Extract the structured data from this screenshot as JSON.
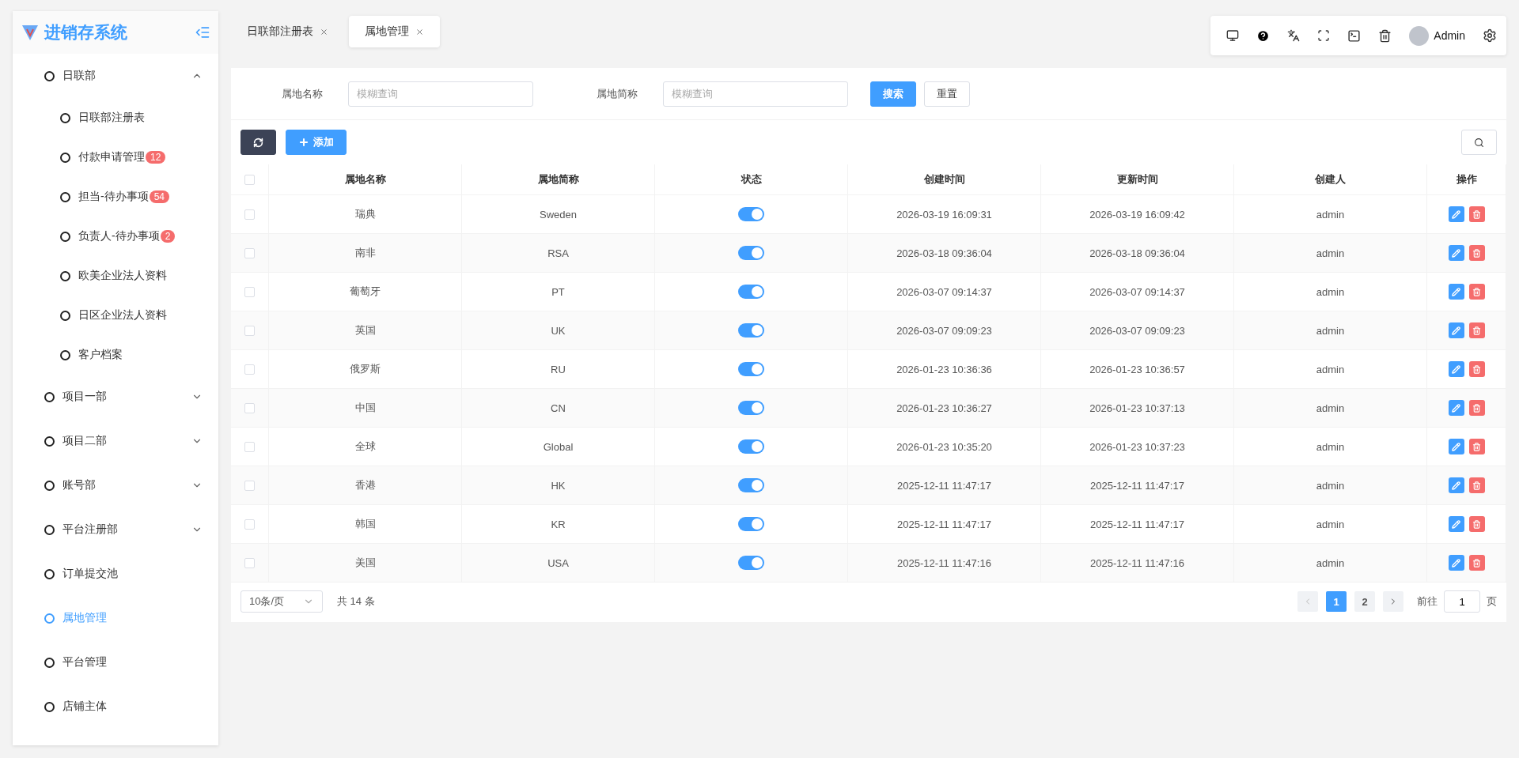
{
  "sidebar": {
    "title": "进销存系统",
    "items": [
      {
        "label": "日联部",
        "expanded": true,
        "selected": false,
        "children": [
          {
            "label": "日联部注册表",
            "selected": false
          },
          {
            "label": "付款申请管理",
            "badge": "12",
            "selected": false
          },
          {
            "label": "担当-待办事项",
            "badge": "54",
            "selected": false
          },
          {
            "label": "负责人-待办事项",
            "badge": "2",
            "selected": false
          },
          {
            "label": "欧美企业法人资料",
            "selected": false
          },
          {
            "label": "日区企业法人资料",
            "selected": false
          },
          {
            "label": "客户档案",
            "selected": false
          }
        ]
      },
      {
        "label": "项目一部",
        "expanded": false,
        "selected": false
      },
      {
        "label": "项目二部",
        "expanded": false,
        "selected": false
      },
      {
        "label": "账号部",
        "expanded": false,
        "selected": false
      },
      {
        "label": "平台注册部",
        "expanded": false,
        "selected": false
      },
      {
        "label": "订单提交池",
        "selected": false
      },
      {
        "label": "属地管理",
        "selected": true
      },
      {
        "label": "平台管理",
        "selected": false
      },
      {
        "label": "店铺主体",
        "selected": false
      }
    ]
  },
  "tabs": [
    {
      "label": "日联部注册表",
      "selected": false
    },
    {
      "label": "属地管理",
      "selected": true
    }
  ],
  "header": {
    "user": "Admin"
  },
  "filters": [
    {
      "label": "属地名称",
      "placeholder": "模糊查询"
    },
    {
      "label": "属地简称",
      "placeholder": "模糊查询"
    }
  ],
  "filter_buttons": {
    "search": "搜索",
    "reset": "重置"
  },
  "toolbar": {
    "add": "添加"
  },
  "table": {
    "all_checked": false,
    "columns": [
      "属地名称",
      "属地简称",
      "状态",
      "创建时间",
      "更新时间",
      "创建人",
      "操作"
    ],
    "rows": [
      {
        "name": "瑞典",
        "abbr": "Sweden",
        "on": true,
        "created": "2026-03-19 16:09:31",
        "updated": "2026-03-19 16:09:42",
        "creator": "admin",
        "checked": false
      },
      {
        "name": "南非",
        "abbr": "RSA",
        "on": true,
        "created": "2026-03-18 09:36:04",
        "updated": "2026-03-18 09:36:04",
        "creator": "admin",
        "checked": false
      },
      {
        "name": "葡萄牙",
        "abbr": "PT",
        "on": true,
        "created": "2026-03-07 09:14:37",
        "updated": "2026-03-07 09:14:37",
        "creator": "admin",
        "checked": false
      },
      {
        "name": "英国",
        "abbr": "UK",
        "on": true,
        "created": "2026-03-07 09:09:23",
        "updated": "2026-03-07 09:09:23",
        "creator": "admin",
        "checked": false
      },
      {
        "name": "俄罗斯",
        "abbr": "RU",
        "on": true,
        "created": "2026-01-23 10:36:36",
        "updated": "2026-01-23 10:36:57",
        "creator": "admin",
        "checked": false
      },
      {
        "name": "中国",
        "abbr": "CN",
        "on": true,
        "created": "2026-01-23 10:36:27",
        "updated": "2026-01-23 10:37:13",
        "creator": "admin",
        "checked": false
      },
      {
        "name": "全球",
        "abbr": "Global",
        "on": true,
        "created": "2026-01-23 10:35:20",
        "updated": "2026-01-23 10:37:23",
        "creator": "admin",
        "checked": false
      },
      {
        "name": "香港",
        "abbr": "HK",
        "on": true,
        "created": "2025-12-11 11:47:17",
        "updated": "2025-12-11 11:47:17",
        "creator": "admin",
        "checked": false
      },
      {
        "name": "韩国",
        "abbr": "KR",
        "on": true,
        "created": "2025-12-11 11:47:17",
        "updated": "2025-12-11 11:47:17",
        "creator": "admin",
        "checked": false
      },
      {
        "name": "美国",
        "abbr": "USA",
        "on": true,
        "created": "2025-12-11 11:47:16",
        "updated": "2025-12-11 11:47:16",
        "creator": "admin",
        "checked": false
      }
    ]
  },
  "pagination": {
    "page_size": "10条/页",
    "total": "共 14 条",
    "pages": [
      {
        "label": "1",
        "selected": true
      },
      {
        "label": "2",
        "selected": false
      }
    ],
    "goto_label": "前往",
    "goto_value": "1",
    "goto_suffix": "页"
  }
}
